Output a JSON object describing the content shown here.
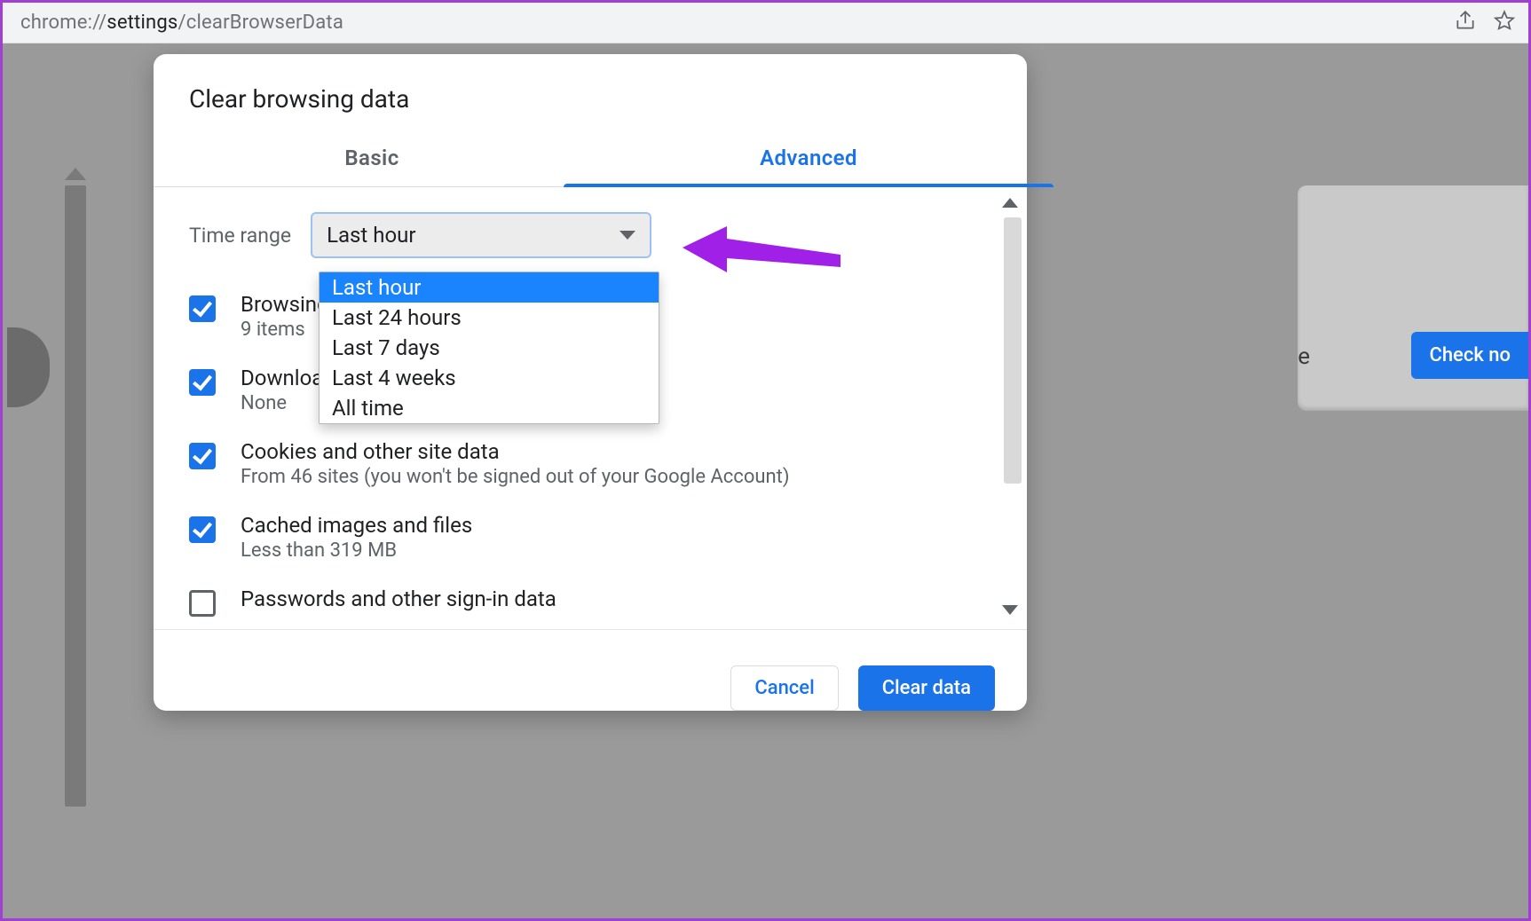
{
  "url": {
    "prefix": "chrome://",
    "highlight": "settings",
    "suffix": "/clearBrowserData"
  },
  "background": {
    "check_now": "Check no",
    "partial_letter": "e"
  },
  "dialog": {
    "title": "Clear browsing data",
    "tabs": {
      "basic": "Basic",
      "advanced": "Advanced"
    },
    "time_range_label": "Time range",
    "time_range_value": "Last hour",
    "time_range_options": [
      "Last hour",
      "Last 24 hours",
      "Last 7 days",
      "Last 4 weeks",
      "All time"
    ],
    "items": [
      {
        "title": "Browsing history",
        "sub": "9 items",
        "checked": true
      },
      {
        "title": "Download history",
        "sub": "None",
        "checked": true
      },
      {
        "title": "Cookies and other site data",
        "sub": "From 46 sites (you won't be signed out of your Google Account)",
        "checked": true
      },
      {
        "title": "Cached images and files",
        "sub": "Less than 319 MB",
        "checked": true
      },
      {
        "title": "Passwords and other sign-in data",
        "sub": "",
        "checked": false
      }
    ],
    "cancel": "Cancel",
    "clear": "Clear data"
  }
}
